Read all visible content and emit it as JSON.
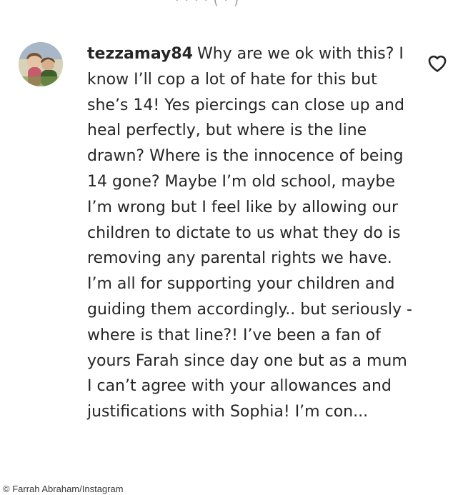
{
  "top_cutoff_text": "· · · · ( · )",
  "comment": {
    "username": "tezzamay84",
    "text": "Why are we ok with this? I know I’ll cop a lot of hate for this but she’s 14! Yes piercings can close up and heal perfectly, but where is the line drawn? Where is the innocence of being 14 gone? Maybe I’m old school, maybe I’m wrong but I feel like by allowing our children to dictate to us what they do is removing any parental rights we have. I’m all for supporting your children and guiding them accordingly.. but seriously - where is that line?! I’ve been a fan of yours Farah since day one but as a mum I can’t agree with your allowances and justifications with Sophia! I’m con...",
    "avatar_icon": "user-avatar-photo",
    "like_icon": "heart-outline-icon"
  },
  "credit": "© Farrah Abraham/Instagram",
  "colors": {
    "text": "#262626",
    "background": "#ffffff",
    "muted": "#8e8e8e"
  }
}
